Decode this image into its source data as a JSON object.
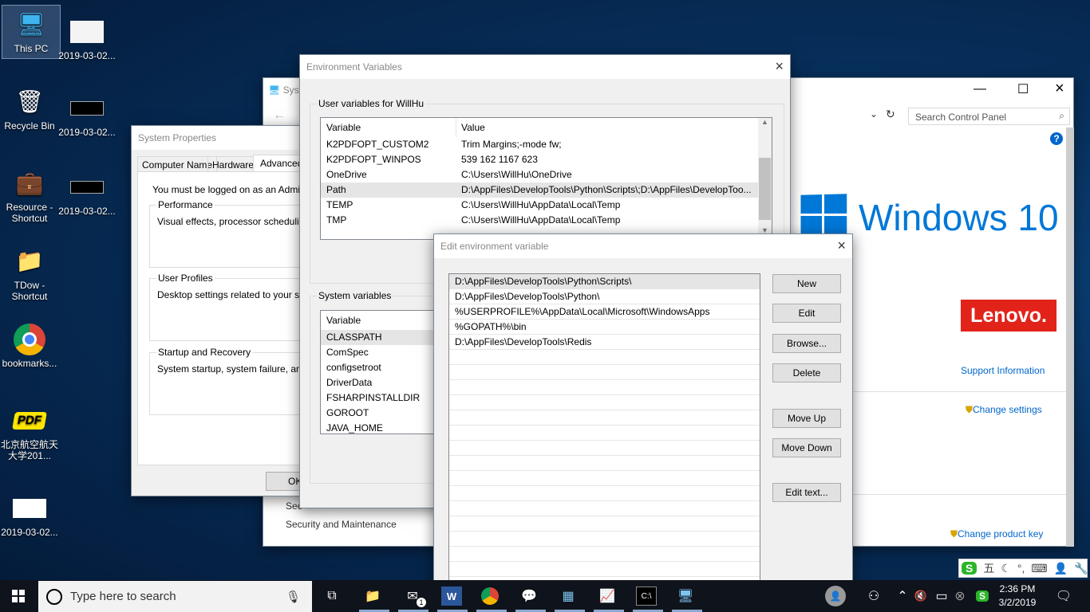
{
  "desktop": {
    "icons": [
      {
        "label": "This PC",
        "icon": "computer-icon"
      },
      {
        "label": "2019-03-02...",
        "icon": "screenshot-thumbnail"
      },
      {
        "label": "Recycle Bin",
        "icon": "recycle-bin-icon"
      },
      {
        "label": "2019-03-02...",
        "icon": "screenshot-thumbnail"
      },
      {
        "label": "Resource - Shortcut",
        "icon": "briefcase-user-icon"
      },
      {
        "label": "2019-03-02...",
        "icon": "screenshot-thumbnail"
      },
      {
        "label": "TDow - Shortcut",
        "icon": "folder-download-icon"
      },
      {
        "label": "bookmarks...",
        "icon": "chrome-icon"
      },
      {
        "label": "北京航空航天大学201...",
        "icon": "pdf-icon"
      },
      {
        "label": "2019-03-02...",
        "icon": "screenshot-thumbnail"
      }
    ]
  },
  "control_panel": {
    "title": "Sys",
    "search_placeholder": "Search Control Panel",
    "windows_brand": "Windows 10",
    "oem_brand": "Lenovo.",
    "support_link": "Support Information",
    "change_settings": "Change settings",
    "change_product_key": "Change product key",
    "see_also": "See",
    "security": "Security and Maintenance"
  },
  "system_properties": {
    "title": "System Properties",
    "tabs": [
      "Computer Name",
      "Hardware",
      "Advanced"
    ],
    "admin_note": "You must be logged on as an Administra",
    "groups": [
      {
        "label": "Performance",
        "text": "Visual effects, processor scheduling, m"
      },
      {
        "label": "User Profiles",
        "text": "Desktop settings related to your sign-in"
      },
      {
        "label": "Startup and Recovery",
        "text": "System startup, system failure, and deb"
      }
    ],
    "ok": "OK"
  },
  "env_vars": {
    "title": "Environment Variables",
    "user_group": "User variables for WillHu",
    "col_variable": "Variable",
    "col_value": "Value",
    "user_vars": [
      {
        "name": "K2PDFOPT_CUSTOM2",
        "value": "Trim Margins;-mode fw;"
      },
      {
        "name": "K2PDFOPT_WINPOS",
        "value": "539 162 1167 623"
      },
      {
        "name": "OneDrive",
        "value": "C:\\Users\\WillHu\\OneDrive"
      },
      {
        "name": "Path",
        "value": "D:\\AppFiles\\DevelopTools\\Python\\Scripts\\;D:\\AppFiles\\DevelopToo..."
      },
      {
        "name": "TEMP",
        "value": "C:\\Users\\WillHu\\AppData\\Local\\Temp"
      },
      {
        "name": "TMP",
        "value": "C:\\Users\\WillHu\\AppData\\Local\\Temp"
      }
    ],
    "system_group": "System variables",
    "system_vars": [
      "CLASSPATH",
      "ComSpec",
      "configsetroot",
      "DriverData",
      "FSHARPINSTALLDIR",
      "GOROOT",
      "JAVA_HOME"
    ]
  },
  "edit_dialog": {
    "title": "Edit environment variable",
    "entries": [
      "D:\\AppFiles\\DevelopTools\\Python\\Scripts\\",
      "D:\\AppFiles\\DevelopTools\\Python\\",
      "%USERPROFILE%\\AppData\\Local\\Microsoft\\WindowsApps",
      "%GOPATH%\\bin",
      "D:\\AppFiles\\DevelopTools\\Redis"
    ],
    "buttons": {
      "new": "New",
      "edit": "Edit",
      "browse": "Browse...",
      "delete": "Delete",
      "move_up": "Move Up",
      "move_down": "Move Down",
      "edit_text": "Edit text..."
    }
  },
  "ime": {
    "mode": "五"
  },
  "taskbar": {
    "search_placeholder": "Type here to search",
    "time": "2:36 PM",
    "date": "3/2/2019",
    "mail_badge": "1"
  },
  "colors": {
    "accent": "#0078d7",
    "link": "#0066cc",
    "lenovo": "#e2231a"
  }
}
